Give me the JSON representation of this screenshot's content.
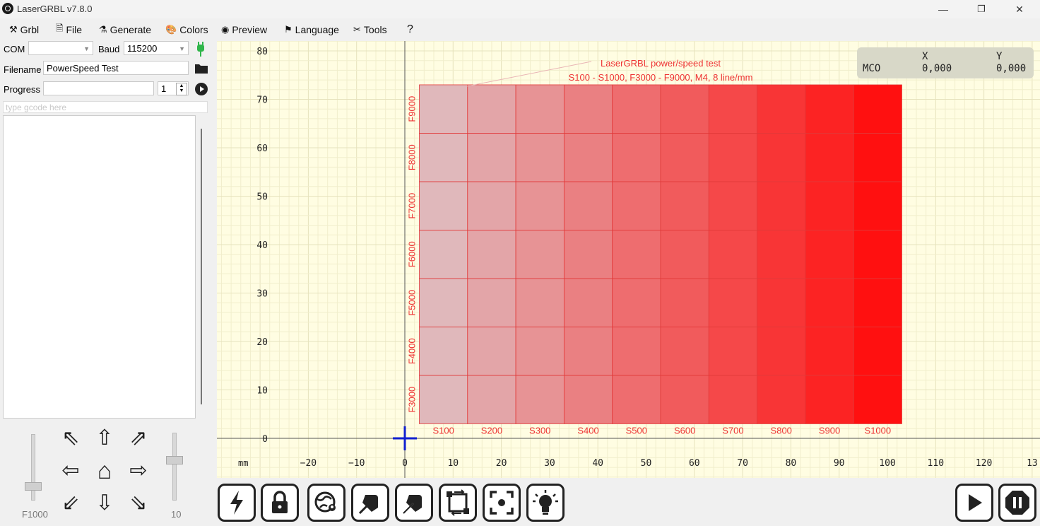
{
  "window": {
    "title": "LaserGRBL v7.8.0",
    "controls": {
      "minimize": "—",
      "maximize": "❐",
      "close": "✕"
    }
  },
  "menu": [
    {
      "label": "Grbl",
      "icon": "tools-icon",
      "glyph": "⚒"
    },
    {
      "label": "File",
      "icon": "file-icon",
      "glyph": "🗎"
    },
    {
      "label": "Generate",
      "icon": "flask-icon",
      "glyph": "⚗"
    },
    {
      "label": "Colors",
      "icon": "palette-icon",
      "glyph": "🎨"
    },
    {
      "label": "Preview",
      "icon": "preview-icon",
      "glyph": "◉"
    },
    {
      "label": "Language",
      "icon": "flag-icon",
      "glyph": "⚑"
    },
    {
      "label": "Tools",
      "icon": "wrench-icon",
      "glyph": "✂"
    },
    {
      "label": "?",
      "icon": "",
      "glyph": ""
    }
  ],
  "connection": {
    "com_label": "COM",
    "com_value": "",
    "baud_label": "Baud",
    "baud_value": "115200",
    "filename_label": "Filename",
    "filename_value": "PowerSpeed Test",
    "progress_label": "Progress",
    "progress_value": "",
    "passes_value": "1",
    "gcode_placeholder": "type gcode here"
  },
  "jog": {
    "speed_label": "F1000",
    "step_label": "10",
    "arrows": {
      "up_left": "⇖",
      "up": "⇧",
      "up_right": "⇗",
      "left": "⇦",
      "home": "⌂",
      "right": "⇨",
      "down_left": "⇙",
      "down": "⇩",
      "down_right": "⇘"
    }
  },
  "position": {
    "axis_x": "X",
    "axis_y": "Y",
    "mode": "MCO",
    "x": "0,000",
    "y": "0,000"
  },
  "chart_data": {
    "type": "heatmap",
    "title": "LaserGRBL power/speed test",
    "subtitle": "S100 - S1000, F3000 - F9000, M4,  8 line/mm",
    "unit_label": "mm",
    "x_ticks": [
      "-20",
      "-10",
      "0",
      "10",
      "20",
      "30",
      "40",
      "50",
      "60",
      "70",
      "80",
      "90",
      "100",
      "110",
      "120",
      "13"
    ],
    "y_ticks": [
      "0",
      "10",
      "20",
      "30",
      "40",
      "50",
      "60",
      "70",
      "80"
    ],
    "xlim": [
      -34,
      136
    ],
    "ylim": [
      -6,
      84
    ],
    "power_labels": [
      "S100",
      "S200",
      "S300",
      "S400",
      "S500",
      "S600",
      "S700",
      "S800",
      "S900",
      "S1000"
    ],
    "speed_labels": [
      "F3000",
      "F4000",
      "F5000",
      "F6000",
      "F7000",
      "F8000",
      "F9000"
    ],
    "grid_x": [
      3,
      103
    ],
    "grid_y": [
      3,
      73
    ],
    "cell_size": 10,
    "color_low": "#e0b8bb",
    "color_high": "#ff1010"
  },
  "toolbar": [
    {
      "name": "flash-button",
      "icon": "lightning-icon"
    },
    {
      "name": "unlock-button",
      "icon": "lock-icon"
    },
    {
      "name": "set-zero-button",
      "icon": "globe-pin-icon"
    },
    {
      "name": "goto-zero-button",
      "icon": "arrow-out-icon"
    },
    {
      "name": "frame-button",
      "icon": "pen-icon"
    },
    {
      "name": "rotate-button",
      "icon": "frame-icon"
    },
    {
      "name": "center-button",
      "icon": "focus-icon"
    },
    {
      "name": "laser-light-button",
      "icon": "bulb-icon"
    }
  ],
  "run_controls": {
    "run": "play-icon",
    "pause": "pause-icon"
  }
}
